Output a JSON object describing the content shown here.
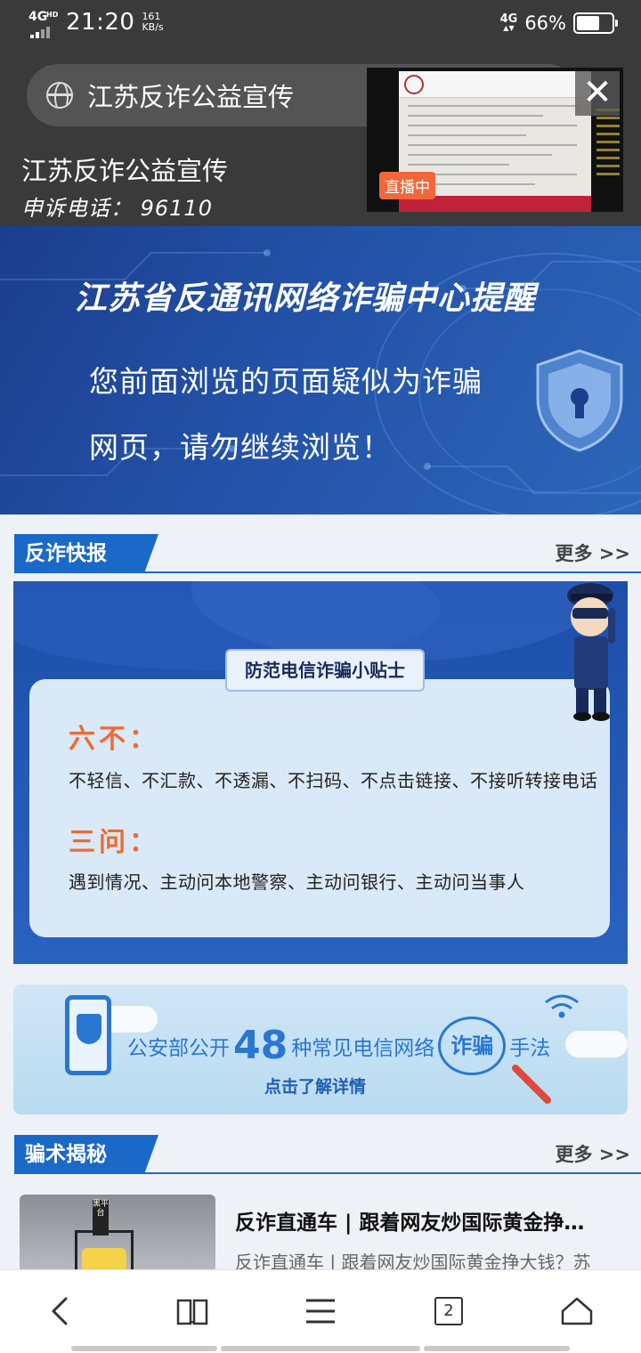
{
  "status_bar": {
    "network_left": "4G",
    "network_hd": "HD",
    "time": "21:20",
    "speed_value": "161",
    "speed_unit": "KB/s",
    "network_right": "4G",
    "battery": "66%",
    "battery_level": 0.66
  },
  "header": {
    "url_text": "江苏反诈公益宣传",
    "site_title": "江苏反诈公益宣传",
    "site_phone": "申诉电话：  96110"
  },
  "live": {
    "badge": "直播中",
    "close_icon": "close-icon"
  },
  "banner": {
    "title": "江苏省反通讯网络诈骗中心提醒",
    "line1": "您前面浏览的页面疑似为诈骗",
    "line2": "网页，请勿继续浏览！"
  },
  "sections": {
    "news": {
      "tag": "反诈快报",
      "more": "更多 >>"
    },
    "secrets": {
      "tag": "骗术揭秘",
      "more": "更多 >>"
    }
  },
  "tips": {
    "label": "防范电信诈骗小贴士",
    "h1": "六不：",
    "t1": "不轻信、不汇款、不透漏、不扫码、不点击链接、不接听转接电话",
    "h2": "三问：",
    "t2": "遇到情况、主动问本地警察、主动问银行、主动问当事人"
  },
  "methods": {
    "prefix": "公安部公开",
    "number": "48",
    "middle": "种常见电信网络",
    "circle": "诈骗",
    "suffix": "手法",
    "link": "点击了解详情"
  },
  "article": {
    "thumb_label": "黑平台",
    "title": "反诈直通车 | 跟着网友炒国际黄金挣…",
    "desc": "反诈直通车 | 跟着网友炒国际黄金挣大钱？苏"
  },
  "bottom_nav": {
    "tabs_count": "2"
  },
  "colors": {
    "accent": "#1a69c8",
    "banner_bg": "#2352a8",
    "tips_heading": "#ef6a30",
    "live_badge": "#f2673a"
  }
}
